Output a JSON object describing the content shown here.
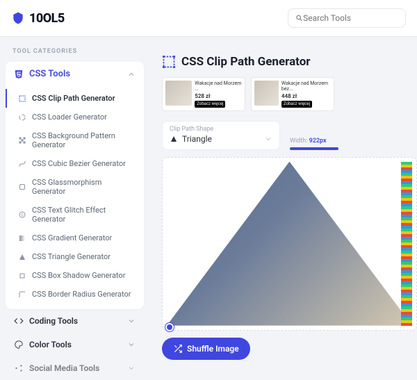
{
  "brand": {
    "name": "10OL5"
  },
  "search": {
    "placeholder": "Search Tools"
  },
  "sidebar": {
    "title": "TOOL CATEGORIES",
    "active_category": {
      "label": "CSS Tools"
    },
    "items": [
      {
        "label": "CSS Clip Path Generator"
      },
      {
        "label": "CSS Loader Generator"
      },
      {
        "label": "CSS Background Pattern Generator"
      },
      {
        "label": "CSS Cubic Bezier Generator"
      },
      {
        "label": "CSS Glassmorphism Generator"
      },
      {
        "label": "CSS Text Glitch Effect Generator"
      },
      {
        "label": "CSS Gradient Generator"
      },
      {
        "label": "CSS Triangle Generator"
      },
      {
        "label": "CSS Box Shadow Generator"
      },
      {
        "label": "CSS Border Radius Generator"
      }
    ],
    "other_categories": [
      {
        "label": "Coding Tools"
      },
      {
        "label": "Color Tools"
      },
      {
        "label": "Social Media Tools"
      }
    ]
  },
  "page": {
    "title": "CSS Clip Path Generator",
    "shape_select": {
      "label": "Clip Path Shape",
      "value": "Triangle"
    },
    "width": {
      "label": "Width:",
      "value": "922px"
    },
    "shuffle_label": "Shuffle Image"
  },
  "ads": [
    {
      "title": "Wakacje nad Morzem ...",
      "price": "528 zł",
      "cta": "Zobacz więcej"
    },
    {
      "title": "Wakacje nad Morzem bez...",
      "price": "448 zł",
      "cta": "Zobacz więcej"
    }
  ]
}
